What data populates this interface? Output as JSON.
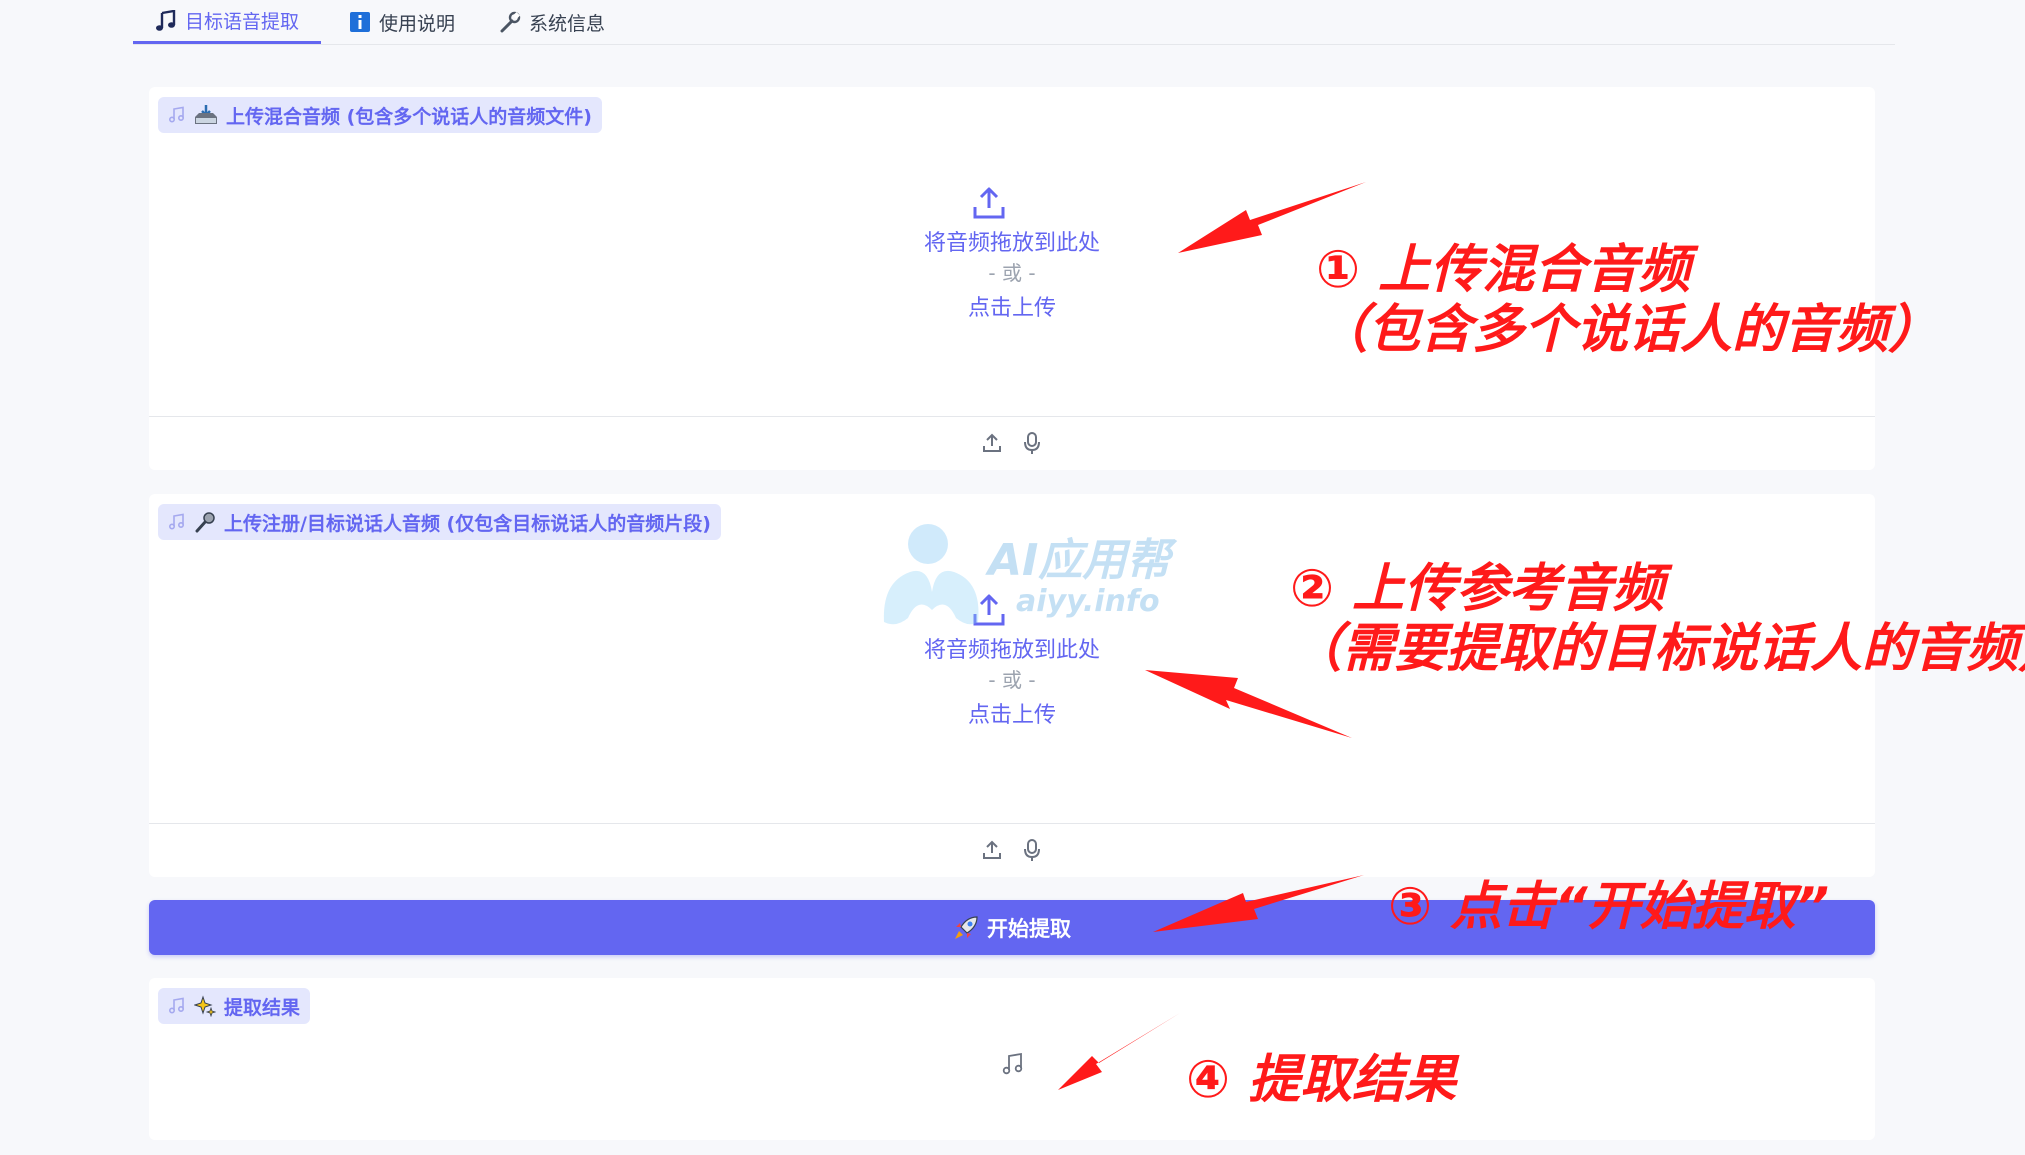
{
  "tabs": [
    {
      "label": "目标语音提取",
      "icon": "music-note-icon",
      "active": true
    },
    {
      "label": "使用说明",
      "icon": "info-icon",
      "active": false
    },
    {
      "label": "系统信息",
      "icon": "wrench-icon",
      "active": false
    }
  ],
  "panels": {
    "mixed": {
      "label": "上传混合音频 (包含多个说话人的音频文件)",
      "drop_text": "将音频拖放到此处",
      "or_text": "- 或 -",
      "click_text": "点击上传"
    },
    "reference": {
      "label": "上传注册/目标说话人音频 (仅包含目标说话人的音频片段)",
      "drop_text": "将音频拖放到此处",
      "or_text": "- 或 -",
      "click_text": "点击上传"
    },
    "result": {
      "label": "提取结果"
    }
  },
  "start_button": {
    "label": "开始提取"
  },
  "annotations": {
    "a1_line1": "① 上传混合音频",
    "a1_line2": "（包含多个说话人的音频）",
    "a2_line1": "② 上传参考音频",
    "a2_line2": "（需要提取的目标说话人的音频）",
    "a3": "③ 点击“开始提取”",
    "a4": "④ 提取结果"
  },
  "watermark": {
    "title": "AI应用帮",
    "url": "aiyy.info"
  },
  "colors": {
    "accent": "#6366f1",
    "chip_bg": "#e4e7fd",
    "annotation": "#ff1a1a",
    "page_bg": "#f7f8fb"
  }
}
